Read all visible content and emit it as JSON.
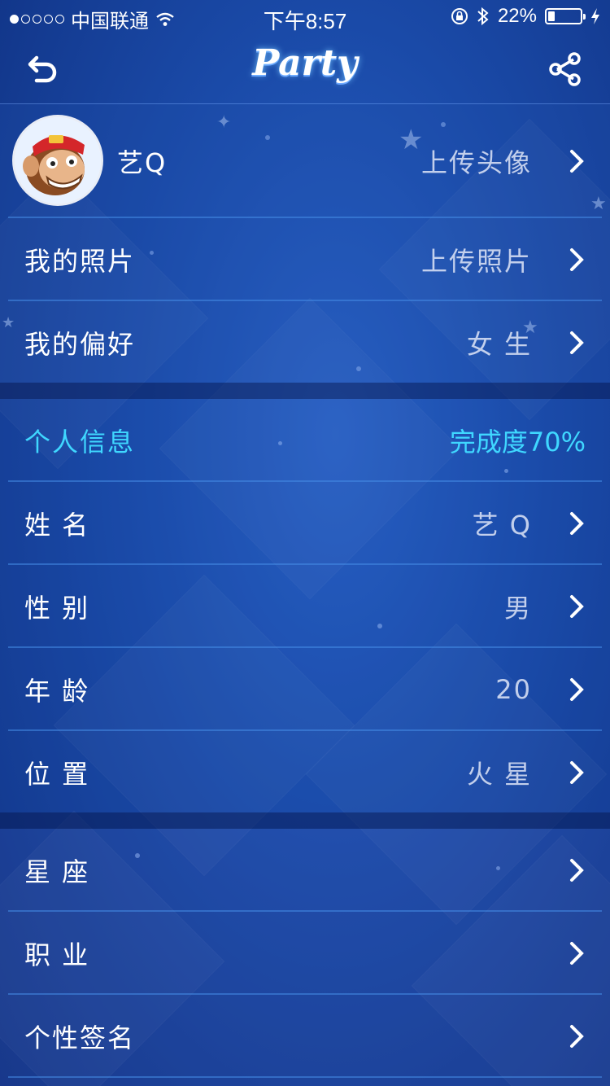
{
  "status_bar": {
    "carrier": "中国联通",
    "time": "下午8:57",
    "battery_percent": "22%",
    "battery_level": 0.22,
    "icons": [
      "signal-dots-icon",
      "wifi-icon",
      "rotation-lock-icon",
      "bluetooth-icon",
      "battery-icon",
      "charging-icon"
    ]
  },
  "nav": {
    "title": "Party",
    "back_icon": "back-arrow-icon",
    "share_icon": "share-icon"
  },
  "profile": {
    "nickname": "艺Q",
    "avatar_action": "上传头像",
    "photos_label": "我的照片",
    "photos_action": "上传照片",
    "preference_label": "我的偏好",
    "preference_value": "女 生"
  },
  "personal_info": {
    "header_label": "个人信息",
    "completion": "完成度70%",
    "completion_percent": 70,
    "name_label": "姓 名",
    "name_value": "艺 Q",
    "gender_label": "性 别",
    "gender_value": "男",
    "age_label": "年 龄",
    "age_value": "20",
    "location_label": "位 置",
    "location_value": "火 星"
  },
  "more_info": {
    "constellation_label": "星 座",
    "job_label": "职 业",
    "signature_label": "个性签名"
  },
  "colors": {
    "accent": "#3fd7ff",
    "background": "#1a4aa8",
    "divider": "#468ce6"
  }
}
